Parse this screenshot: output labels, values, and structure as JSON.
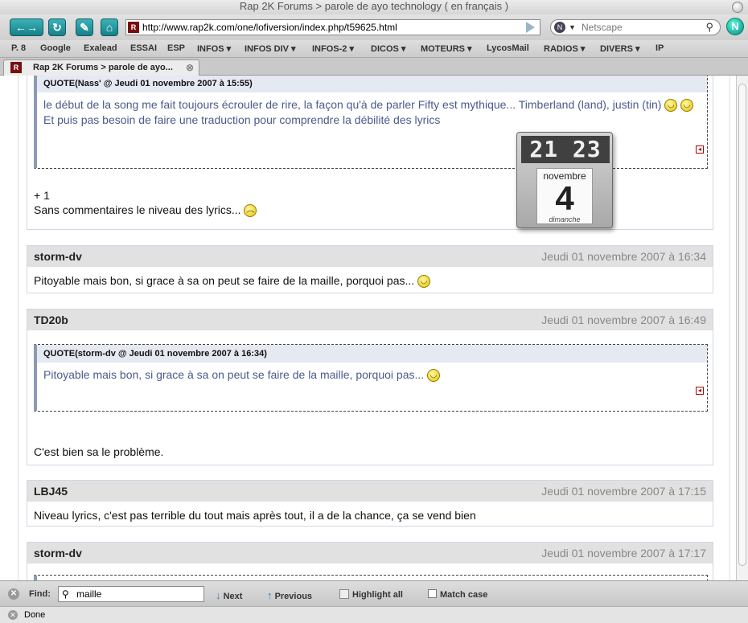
{
  "window": {
    "title": "Rap 2K Forums > parole de ayo technology ( en français )"
  },
  "toolbar": {
    "back_glyph": "←→",
    "reload_glyph": "↻",
    "bookmarks_glyph": "✎",
    "home_glyph": "⌂",
    "url": "http://www.rap2k.com/one/lofiversion/index.php/t59625.html",
    "favicon_letter": "R",
    "search_placeholder": "Netscape",
    "search_engine_glyph": "N",
    "logo_letter": "N"
  },
  "bookmarks": [
    "P. 8",
    "Google",
    "Exalead",
    "ESSAI",
    "ESP",
    "INFOS ▾",
    "INFOS DIV ▾",
    "INFOS-2 ▾",
    "DICOS ▾",
    "MOTEURS ▾",
    "LycosMail",
    "RADIOS ▾",
    "DIVERS ▾",
    "IP"
  ],
  "tab": {
    "label": "Rap 2K Forums > parole de ayo...",
    "favicon_letter": "R",
    "close_glyph": "⊗"
  },
  "posts": {
    "p0": {
      "quote_header": "QUOTE(Nass' @ Jeudi 01 novembre 2007 à 15:55)",
      "quote_line1": "le début de la song me fait toujours écrouler de rire, la façon qu'à de parler Fifty est mythique... Timberland (land), justin (tin)",
      "quote_line2": "Et puis pas besoin de faire une traduction pour comprendre la débilité des lyrics",
      "line1": "+ 1",
      "line2": "Sans commentaires le niveau des lyrics..."
    },
    "p1": {
      "author": "storm-dv",
      "date": "Jeudi 01 novembre 2007 à 16:34",
      "body": "Pitoyable mais bon, si grace à sa on peut se faire de la maille, porquoi pas..."
    },
    "p2": {
      "author": "TD20b",
      "date": "Jeudi 01 novembre 2007 à 16:49",
      "quote_header": "QUOTE(storm-dv @ Jeudi 01 novembre 2007 à 16:34)",
      "quote_body": "Pitoyable mais bon, si grace à sa on peut se faire de la maille, porquoi pas...",
      "body": "C'est bien sa le problème."
    },
    "p3": {
      "author": "LBJ45",
      "date": "Jeudi 01 novembre 2007 à 17:15",
      "body": "Niveau lyrics, c'est pas terrible du tout mais après tout, il a de la chance, ça se vend bien"
    },
    "p4": {
      "author": "storm-dv",
      "date": "Jeudi 01 novembre 2007 à 17:17"
    }
  },
  "widget": {
    "time": "21 23",
    "month": "novembre",
    "day": "4",
    "weekday": "dimanche"
  },
  "findbar": {
    "label": "Find:",
    "query": "maille",
    "next": "Next",
    "previous": "Previous",
    "highlight_all": "Highlight all",
    "match_case": "Match case"
  },
  "status": {
    "text": "Done"
  },
  "colors": {
    "quote_text": "#4b5a8c",
    "post_header": "#e1e1e1",
    "date_text": "#888888",
    "accent_teal": "#177f88"
  }
}
